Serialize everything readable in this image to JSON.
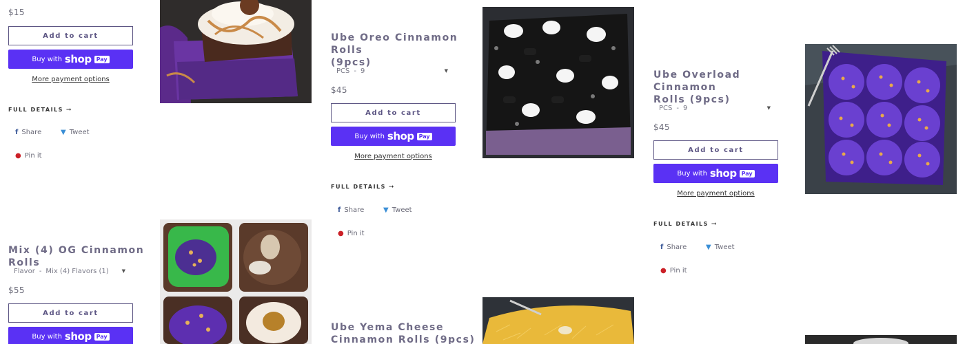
{
  "common": {
    "add_to_cart": "Add to cart",
    "buy_with": "Buy with",
    "shop_word": "shop",
    "pay_word": "Pay",
    "more_payment_options": "More payment options",
    "full_details": "FULL DETAILS",
    "share": "Share",
    "tweet": "Tweet",
    "pin": "Pin it"
  },
  "icons": {
    "facebook": "facebook-icon",
    "twitter": "twitter-icon",
    "pinterest": "pinterest-icon",
    "arrow": "arrow-right-icon",
    "caret": "caret-down-icon"
  },
  "colors": {
    "accent": "#5a31f4",
    "title": "#6f6b86",
    "button_border": "#5d5684"
  },
  "products": {
    "p0": {
      "price": "$15"
    },
    "p1": {
      "title_line1": "Ube Oreo Cinnamon Rolls",
      "title_line2": "(9pcs)",
      "variant_label": "PCS",
      "variant_value": "9",
      "price": "$45"
    },
    "p2": {
      "title_line1": "Ube Overload Cinnamon",
      "title_line2": "Rolls (9pcs)",
      "variant_label": "PCS",
      "variant_value": "9",
      "price": "$45"
    },
    "p3": {
      "title": "Mix (4) OG Cinnamon Rolls",
      "variant_label": "Flavor",
      "variant_value": "Mix (4) Flavors (1)",
      "price": "$55"
    },
    "p4": {
      "title_line1": "Ube Yema Cheese",
      "title_line2": "Cinnamon Rolls (9pcs)"
    }
  }
}
